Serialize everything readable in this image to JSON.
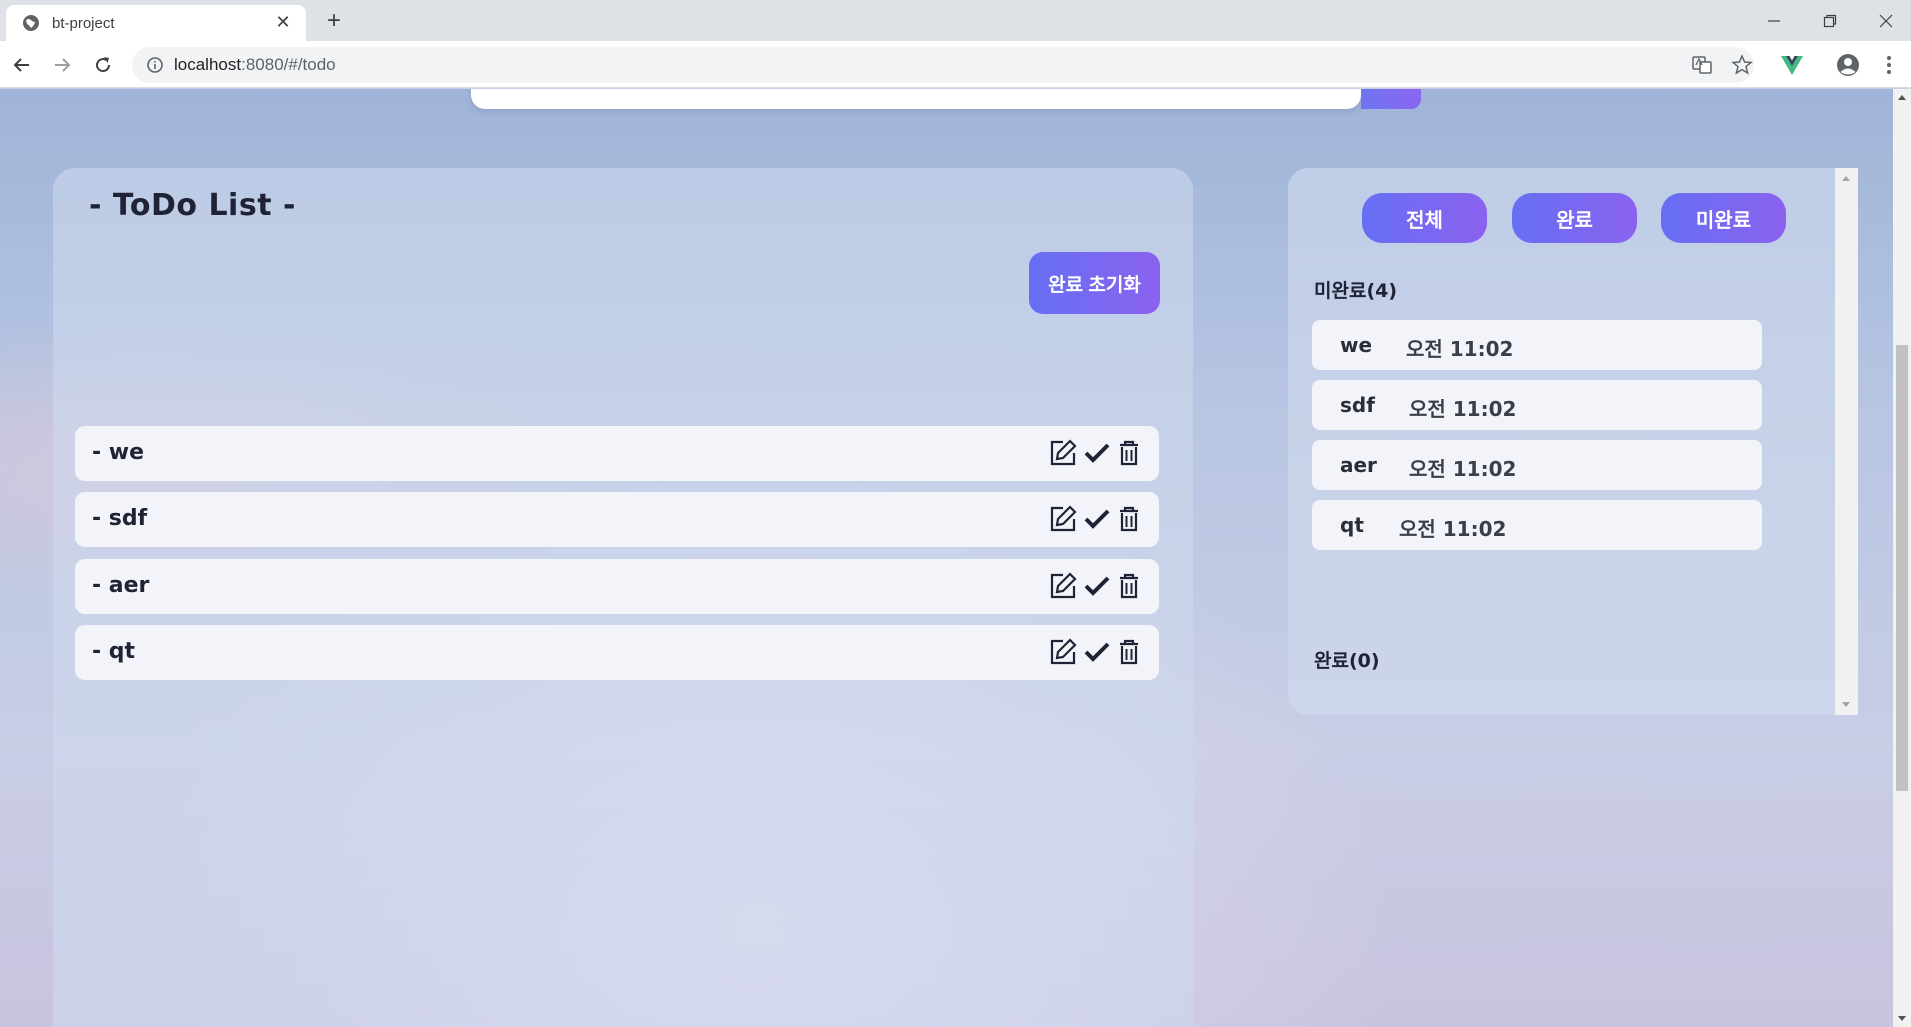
{
  "browser": {
    "tab_title": "bt-project",
    "tab_close": "✕",
    "new_tab": "+",
    "url_host": "localhost",
    "url_rest": ":8080/#/todo"
  },
  "todo_panel": {
    "title": "- ToDo List -",
    "reset_label": "완료 초기화",
    "items": [
      {
        "text": "- we"
      },
      {
        "text": "- sdf"
      },
      {
        "text": "- aer"
      },
      {
        "text": "- qt"
      }
    ]
  },
  "filter_panel": {
    "buttons": [
      "전체",
      "완료",
      "미완료"
    ],
    "incomplete_label": "미완료(4)",
    "complete_label": "완료(0)",
    "items": [
      {
        "text": "we",
        "time": "오전 11:02"
      },
      {
        "text": "sdf",
        "time": "오전 11:02"
      },
      {
        "text": "aer",
        "time": "오전 11:02"
      },
      {
        "text": "qt",
        "time": "오전 11:02"
      }
    ]
  },
  "colors": {
    "accent_start": "#666ff3",
    "accent_end": "#8b62ef"
  }
}
